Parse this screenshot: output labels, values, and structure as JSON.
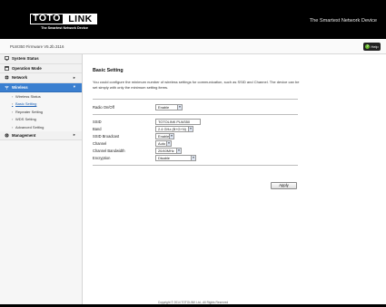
{
  "header": {
    "logo_left": "TOTO",
    "logo_right": "LINK",
    "logo_subtitle": "The Smartest Network Device",
    "tagline": "The Smartest Network Device"
  },
  "subbar": {
    "firmware": "PLW350 Firmware V5.2b.3116",
    "help_label": "Help"
  },
  "sidebar": {
    "items": [
      {
        "label": "System Status",
        "icon": "monitor-icon"
      },
      {
        "label": "Operation Mode",
        "icon": "window-icon"
      },
      {
        "label": "Network",
        "icon": "globe-icon",
        "arrow": "▸"
      },
      {
        "label": "Wireless",
        "icon": "wifi-icon",
        "arrow": "▾"
      },
      {
        "label": "Management",
        "icon": "gear-icon",
        "arrow": "▸"
      }
    ],
    "wireless_sub": [
      "Wireless Status",
      "Basic Setting",
      "Repeater Setting",
      "WDS Setting",
      "Advanced Setting"
    ]
  },
  "main": {
    "title": "Basic Setting",
    "description": "You could configure the minimum number of wireless settings for communication, such as SSID and Channel. The device can be set simply with only the minimum setting items.",
    "radio_label": "Radio On/Off",
    "radio_value": "Enable",
    "fields": [
      {
        "label": "SSID",
        "value": "TOTOLINK PLW350",
        "kind": "text"
      },
      {
        "label": "Band",
        "value": "2.4 GHz (B+G+N)",
        "kind": "select"
      },
      {
        "label": "SSID Broadcast",
        "value": "Enable",
        "kind": "select"
      },
      {
        "label": "Channel",
        "value": "Auto",
        "kind": "select"
      },
      {
        "label": "Channel Bandwidth",
        "value": "20/40MHz",
        "kind": "select"
      },
      {
        "label": "Encryption",
        "value": "Disable",
        "kind": "select"
      }
    ],
    "apply_label": "Apply"
  },
  "footer": {
    "copyright": "Copyright © 2014 TOTOLINK Ltd.,  All Rights Reserved"
  },
  "colors": {
    "header_bg": "#000000",
    "active_menu": "#3a7fd0",
    "help_icon": "#6bbf2f"
  }
}
